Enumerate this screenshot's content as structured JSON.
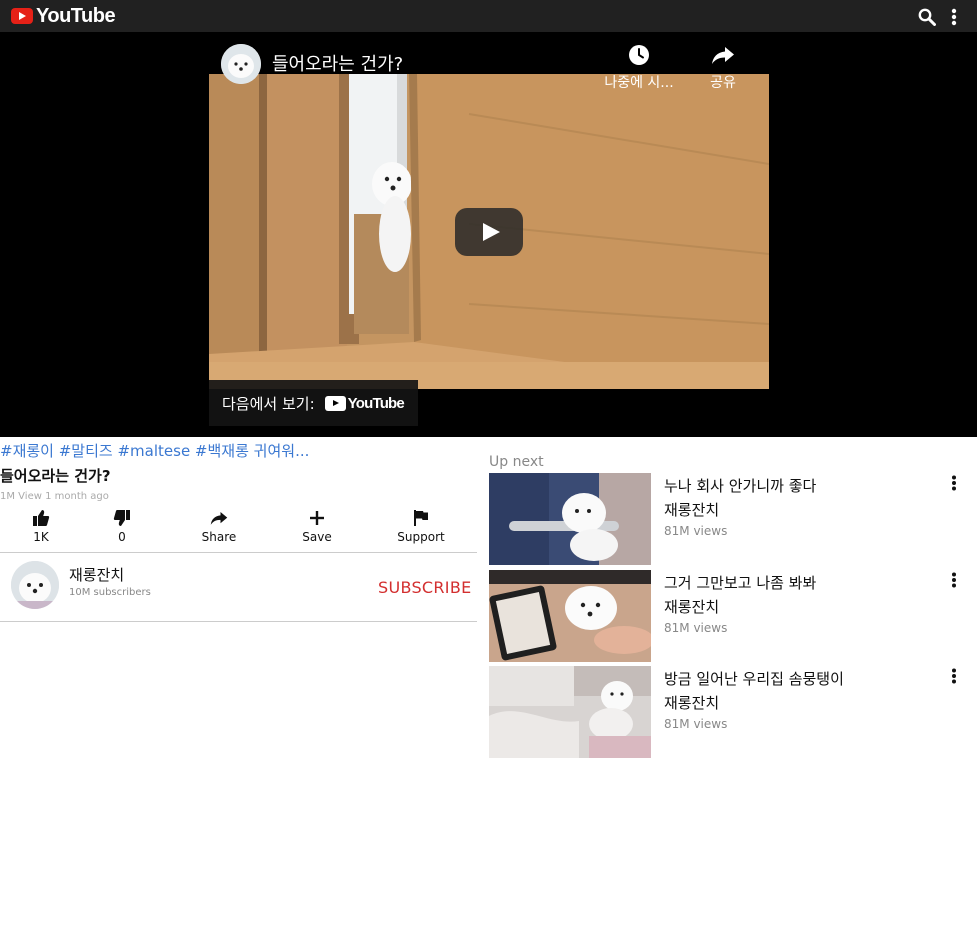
{
  "header": {
    "logo_text": "YouTube",
    "search_icon": "search-icon",
    "more_icon": "more-vert-icon"
  },
  "player": {
    "title": "들어오라는 건가?",
    "watch_later_label": "나중에 시...",
    "share_label": "공유",
    "watch_on_label": "다음에서 보기:",
    "watch_on_logo": "YouTube",
    "play_icon": "play-icon"
  },
  "video": {
    "tags": "#재롱이 #말티즈 #maltese #백재롱 귀여워...",
    "title": "들어오라는 건가?",
    "meta": "1M View 1 month ago",
    "actions": [
      {
        "label": "1K",
        "icon": "thumbs-up-icon"
      },
      {
        "label": "0",
        "icon": "thumbs-down-icon"
      },
      {
        "label": "Share",
        "icon": "share-icon"
      },
      {
        "label": "Save",
        "icon": "plus-icon"
      },
      {
        "label": "Support",
        "icon": "flag-icon"
      }
    ]
  },
  "channel": {
    "name": "재롱잔치",
    "subscribers": "10M subscribers",
    "subscribe_label": "SUBSCRIBE"
  },
  "up_next": {
    "label": "Up next",
    "items": [
      {
        "title": "누나 회사 안가니까 좋다",
        "channel": "재롱잔치",
        "views": "81M views"
      },
      {
        "title": "그거 그만보고 나좀 봐봐",
        "channel": "재롱잔치",
        "views": "81M views"
      },
      {
        "title": "방금 일어난 우리집 솜뭉탱이",
        "channel": "재롱잔치",
        "views": "81M views"
      }
    ]
  },
  "colors": {
    "brand_red": "#e62117",
    "link_blue": "#3b78d1",
    "subscribe_red": "#d32f2f",
    "topbar_bg": "#212121"
  }
}
